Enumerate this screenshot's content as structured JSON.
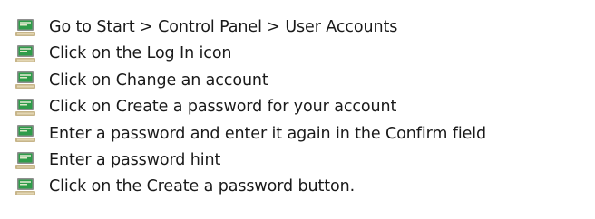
{
  "instructions": {
    "bullet_icon": "computer-monitor-icon",
    "steps": [
      "Go to Start > Control Panel > User Accounts",
      "Click on the Log In icon",
      "Click on Change an account",
      "Click on Create a password for your account",
      "Enter a password and enter it again in the Confirm field",
      "Enter a password hint",
      "Click on the Create a password button."
    ]
  },
  "colors": {
    "text": "#1a1a1a",
    "monitor_frame": "#8f8f8f",
    "monitor_screen": "#2f9c4a",
    "monitor_base": "#c7b58a"
  }
}
